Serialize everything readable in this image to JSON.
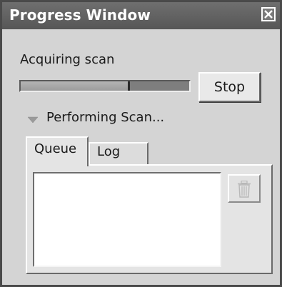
{
  "window": {
    "title": "Progress Window",
    "close_icon": "close-icon"
  },
  "status": {
    "label": "Acquiring scan",
    "progress": 0.65
  },
  "buttons": {
    "stop_label": "Stop",
    "delete_icon": "trash-icon"
  },
  "section": {
    "label": "Performing Scan...",
    "expanded": true,
    "icon": "triangle-down-icon"
  },
  "tabs": [
    {
      "label": "Queue",
      "active": true
    },
    {
      "label": "Log",
      "active": false
    }
  ],
  "queue": {
    "items": []
  },
  "colors": {
    "titlebar": "#5e5e5e",
    "panel": "#d4d4d4",
    "list_bg": "#ffffff"
  }
}
